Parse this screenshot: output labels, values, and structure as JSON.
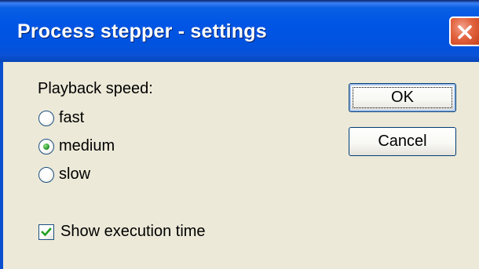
{
  "window": {
    "title": "Process stepper - settings",
    "close_icon": "close-icon"
  },
  "settings": {
    "speed_label": "Playback speed:",
    "speed_options": [
      {
        "label": "fast",
        "checked": false
      },
      {
        "label": "medium",
        "checked": true
      },
      {
        "label": "slow",
        "checked": false
      }
    ],
    "show_time_label": "Show execution time",
    "show_time_checked": true
  },
  "buttons": {
    "ok_label": "OK",
    "cancel_label": "Cancel"
  },
  "colors": {
    "titlebar": "#0055e5",
    "dialog_bg": "#ece9d8",
    "close_button": "#e2643f",
    "radio_dot": "#2e9a2c",
    "checkmark": "#21a121"
  }
}
